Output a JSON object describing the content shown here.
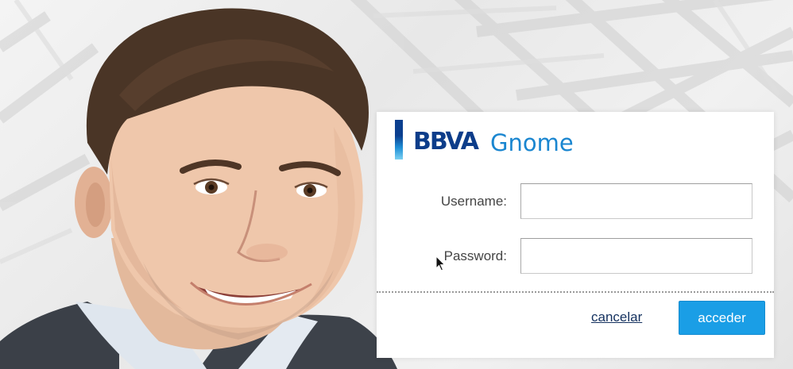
{
  "brand": {
    "logo_text": "BBVA",
    "app_name": "Gnome",
    "logo_colors": [
      "#0b3f8f",
      "#1f8fd6",
      "#7cd0f2"
    ],
    "app_name_color": "#1a86d0"
  },
  "login_form": {
    "username_label": "Username:",
    "username_value": "",
    "password_label": "Password:",
    "password_value": "",
    "cancel_label": "cancelar",
    "submit_label": "acceder",
    "submit_color": "#1a9ee6"
  },
  "background": {
    "image": "smiling-man-photo"
  },
  "icons": {
    "pointer": "mouse-pointer-icon"
  }
}
